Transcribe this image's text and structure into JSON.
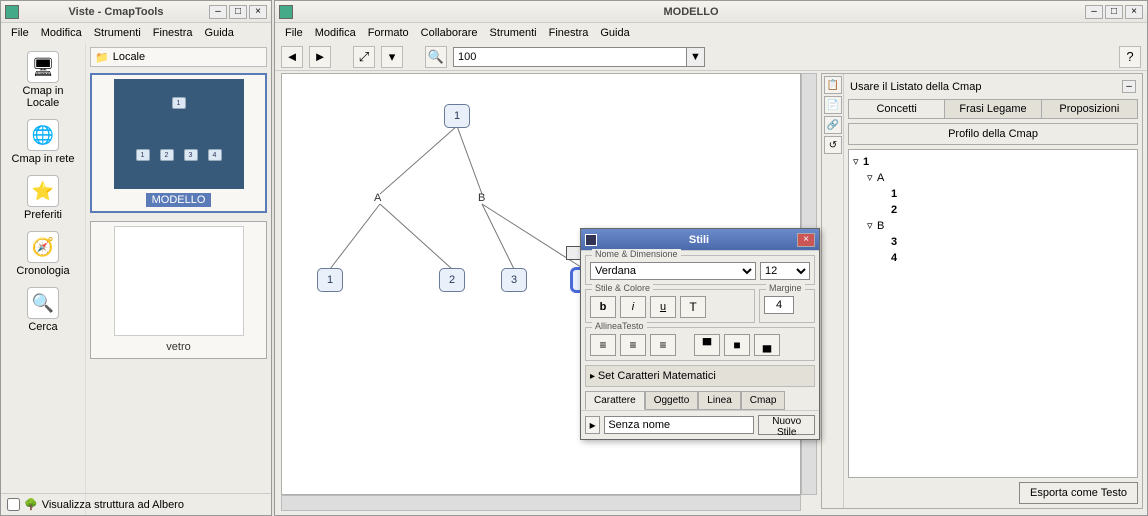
{
  "views": {
    "title": "Viste - CmapTools",
    "menu": [
      "File",
      "Modifica",
      "Strumenti",
      "Finestra",
      "Guida"
    ],
    "nav": [
      {
        "label": "Cmap in Locale",
        "icon": "🖥"
      },
      {
        "label": "Cmap in rete",
        "icon": "🌐"
      },
      {
        "label": "Preferiti",
        "icon": "⭐"
      },
      {
        "label": "Cronologia",
        "icon": "🧭"
      },
      {
        "label": "Cerca",
        "icon": "🔍"
      }
    ],
    "location": "Locale",
    "thumbs": [
      {
        "label": "MODELLO",
        "selected": true
      },
      {
        "label": "vetro",
        "selected": false
      }
    ],
    "footer_checkbox_label": "Visualizza struttura ad Albero"
  },
  "model": {
    "title": "MODELLO",
    "menu": [
      "File",
      "Modifica",
      "Formato",
      "Collaborare",
      "Strumenti",
      "Finestra",
      "Guida"
    ],
    "zoom": "100",
    "nodes": {
      "root": "1",
      "linkA": "A",
      "linkB": "B",
      "a1": "1",
      "a2": "2",
      "b1": "3",
      "b2": "4"
    }
  },
  "rpanel": {
    "title": "Usare il Listato della Cmap",
    "tabs": [
      "Concetti",
      "Frasi Legame",
      "Proposizioni"
    ],
    "profile_header": "Profilo della Cmap",
    "tree": {
      "root": "1",
      "children": [
        {
          "label": "A",
          "children": [
            "1",
            "2"
          ]
        },
        {
          "label": "B",
          "children": [
            "3",
            "4"
          ]
        }
      ]
    },
    "export": "Esporta come Testo"
  },
  "stili": {
    "title": "Stili",
    "sec_name": "Nome & Dimensione",
    "font": "Verdana",
    "size": "12",
    "sec_style": "Stile & Colore",
    "sec_margin": "Margine",
    "margin": "4",
    "sec_align": "AllineaTesto",
    "math": "Set Caratteri Matematici",
    "tabs": [
      "Carattere",
      "Oggetto",
      "Linea",
      "Cmap"
    ],
    "noname": "Senza nome",
    "newstyle": "Nuovo Stile"
  }
}
